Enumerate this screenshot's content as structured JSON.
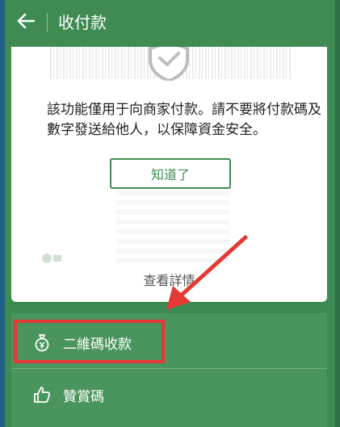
{
  "header": {
    "title": "收付款",
    "back_icon": "back-arrow-icon"
  },
  "card": {
    "notice_text": "該功能僅用于向商家付款。請不要將付款碼及數字發送給他人，以保障資金安全。",
    "ok_label": "知道了",
    "details_label": "查看詳情",
    "shield_icon": "shield-check-icon"
  },
  "menu": {
    "items": [
      {
        "label": "二維碼收款",
        "icon": "money-bag-icon"
      },
      {
        "label": "贊賞碼",
        "icon": "thumbs-up-icon"
      }
    ]
  },
  "annotation": {
    "highlight_color": "#e53935",
    "arrow_color": "#e53935"
  },
  "colors": {
    "brand_green": "#3f8b53",
    "menu_green": "#4a955d"
  }
}
